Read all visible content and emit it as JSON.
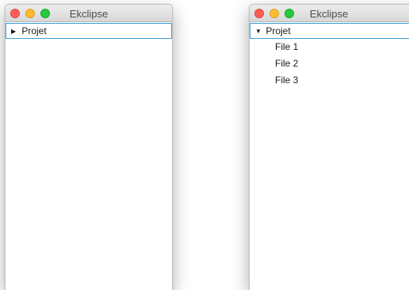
{
  "windows": [
    {
      "title": "Ekclipse",
      "tree": {
        "root": {
          "label": "Projet",
          "expanded": false,
          "disclosure_glyph": "▶"
        },
        "children": []
      }
    },
    {
      "title": "Ekclipse",
      "tree": {
        "root": {
          "label": "Projet",
          "expanded": true,
          "disclosure_glyph": "▼"
        },
        "children": [
          {
            "label": "File 1"
          },
          {
            "label": "File 2"
          },
          {
            "label": "File 3"
          }
        ]
      }
    }
  ],
  "colors": {
    "close": "#fe5f57",
    "minimize": "#febc2e",
    "zoom": "#28c840",
    "selection_border": "#3aa0d8"
  }
}
